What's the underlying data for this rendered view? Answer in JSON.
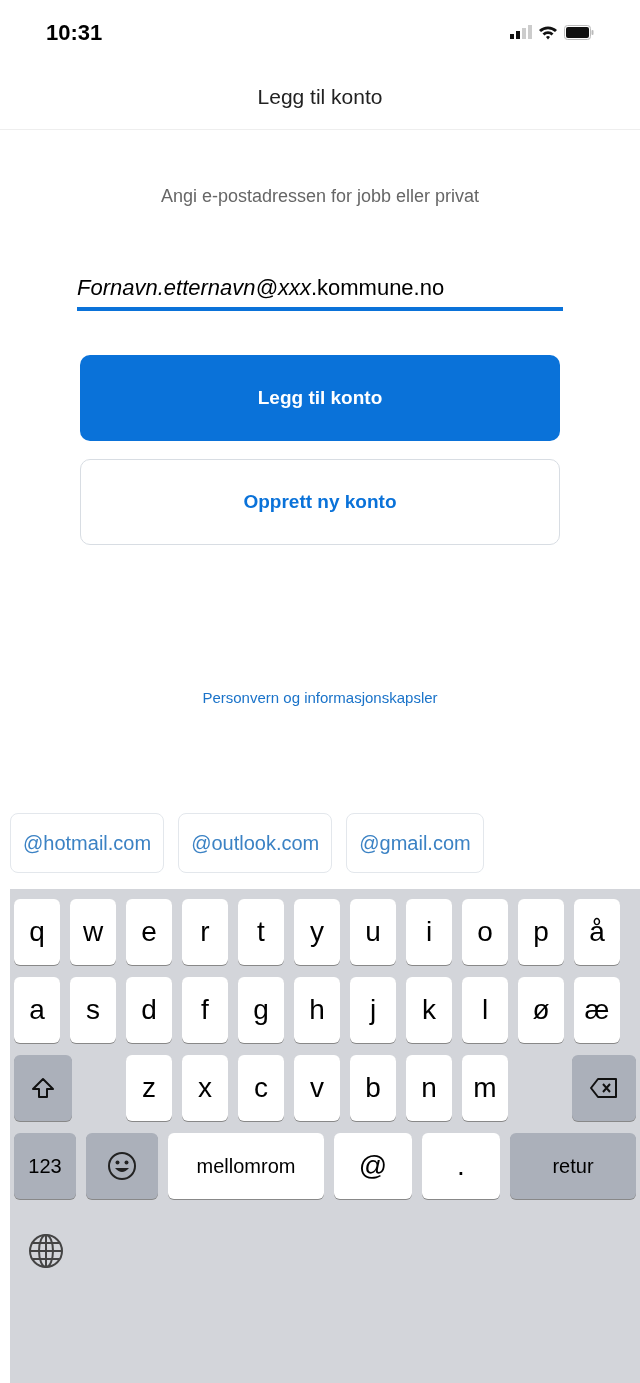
{
  "status_bar": {
    "time": "10:31"
  },
  "header": {
    "title": "Legg til konto"
  },
  "instruction": "Angi e-postadressen for jobb eller privat",
  "email_field": {
    "value": "*Fornavn.etternavn@xxx*.kommune.no",
    "focused": true
  },
  "buttons": [
    {
      "label": "Legg til konto",
      "kind": "primary"
    },
    {
      "label": "Opprett ny konto",
      "kind": "secondary"
    }
  ],
  "privacy_link": "Personvern og informasjonskapsler",
  "suggestions": [
    "@hotmail.com",
    "@outlook.com",
    "@gmail.com"
  ],
  "keyboard": {
    "rows": [
      [
        {
          "kind": "letter",
          "label": "q"
        },
        {
          "kind": "letter",
          "label": "w"
        },
        {
          "kind": "letter",
          "label": "e"
        },
        {
          "kind": "letter",
          "label": "r"
        },
        {
          "kind": "letter",
          "label": "t"
        },
        {
          "kind": "letter",
          "label": "y"
        },
        {
          "kind": "letter",
          "label": "u"
        },
        {
          "kind": "letter",
          "label": "i"
        },
        {
          "kind": "letter",
          "label": "o"
        },
        {
          "kind": "letter",
          "label": "p"
        },
        {
          "kind": "letter",
          "label": "å"
        }
      ],
      [
        {
          "kind": "letter",
          "label": "a"
        },
        {
          "kind": "letter",
          "label": "s"
        },
        {
          "kind": "letter",
          "label": "d"
        },
        {
          "kind": "letter",
          "label": "f"
        },
        {
          "kind": "letter",
          "label": "g"
        },
        {
          "kind": "letter",
          "label": "h"
        },
        {
          "kind": "letter",
          "label": "j"
        },
        {
          "kind": "letter",
          "label": "k"
        },
        {
          "kind": "letter",
          "label": "l"
        },
        {
          "kind": "letter",
          "label": "ø"
        },
        {
          "kind": "letter",
          "label": "æ"
        }
      ],
      [
        {
          "kind": "shift"
        },
        "",
        {
          "kind": "letter",
          "label": "z"
        },
        {
          "kind": "letter",
          "label": "x"
        },
        {
          "kind": "letter",
          "label": "c"
        },
        {
          "kind": "letter",
          "label": "v"
        },
        {
          "kind": "letter",
          "label": "b"
        },
        {
          "kind": "letter",
          "label": "n"
        },
        {
          "kind": "letter",
          "label": "m"
        },
        {
          "kind": "backspace"
        }
      ]
    ],
    "bottom_row": [
      {
        "kind": "function",
        "label": "123"
      },
      {
        "kind": "emoji"
      },
      {
        "kind": "space",
        "label": "mellomrom"
      },
      {
        "kind": "letter",
        "label": "@"
      },
      {
        "kind": "letter",
        "label": "."
      },
      {
        "kind": "return",
        "label": "retur"
      }
    ]
  }
}
